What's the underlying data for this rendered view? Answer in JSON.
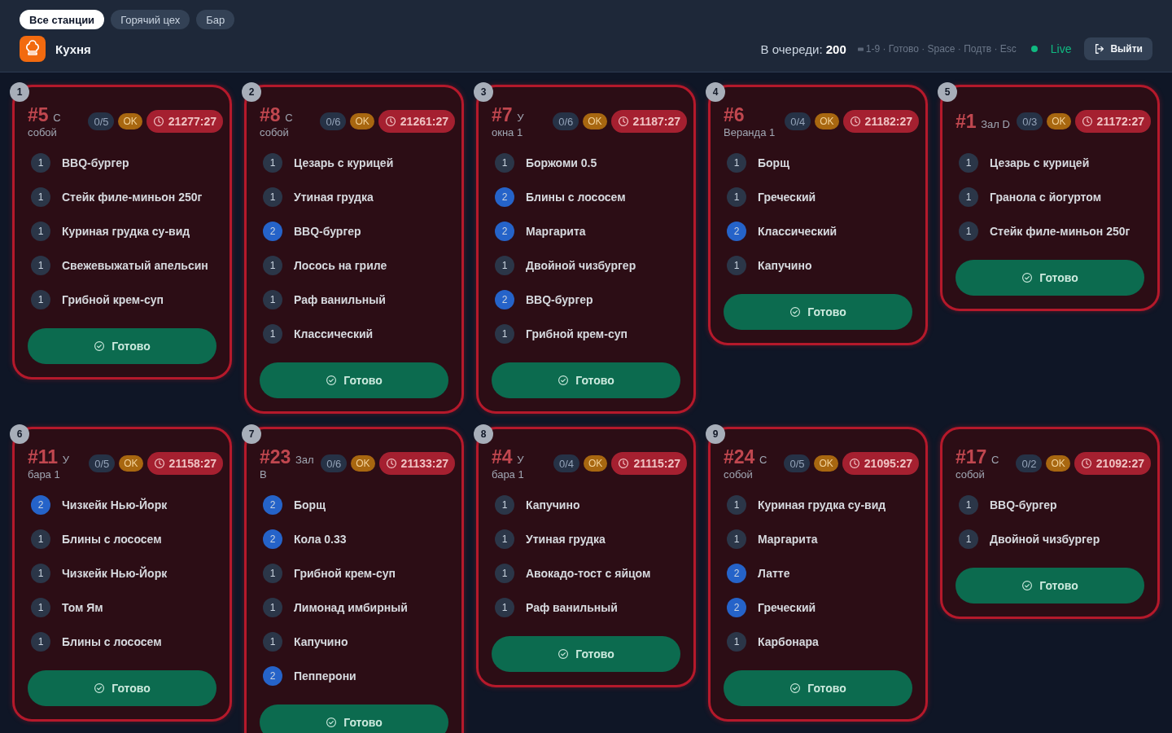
{
  "tabs": [
    {
      "label": "Все станции",
      "selected": true
    },
    {
      "label": "Горячий цех",
      "selected": false
    },
    {
      "label": "Бар",
      "selected": false
    }
  ],
  "station": {
    "title": "Кухня"
  },
  "queue": {
    "label": "В очереди:",
    "count": "200"
  },
  "hints": "1-9 · Готово · Space · Подтв · Esc",
  "live": {
    "label": "Live",
    "on": true
  },
  "logout": "Выйти",
  "orders": [
    {
      "hotkey": "1",
      "number": "#5",
      "place": "С собой",
      "progress": "0/5",
      "status": "OK",
      "timer": "21277:27",
      "overdue": true,
      "done_label": "Готово",
      "items": [
        {
          "qty": "1",
          "name": "BBQ-бургер",
          "color": "#2b3648"
        },
        {
          "qty": "1",
          "name": "Стейк филе-миньон 250г",
          "color": "#2b3648"
        },
        {
          "qty": "1",
          "name": "Куриная грудка су-вид",
          "color": "#2b3648"
        },
        {
          "qty": "1",
          "name": "Свежевыжатый апельсин",
          "color": "#2b3648"
        },
        {
          "qty": "1",
          "name": "Грибной крем-суп",
          "color": "#2b3648"
        }
      ]
    },
    {
      "hotkey": "2",
      "number": "#8",
      "place": "С собой",
      "progress": "0/6",
      "status": "OK",
      "timer": "21261:27",
      "overdue": true,
      "done_label": "Готово",
      "items": [
        {
          "qty": "1",
          "name": "Цезарь с курицей",
          "color": "#2b3648"
        },
        {
          "qty": "1",
          "name": "Утиная грудка",
          "color": "#2b3648"
        },
        {
          "qty": "2",
          "name": "BBQ-бургер",
          "color": "#2563c9"
        },
        {
          "qty": "1",
          "name": "Лосось на гриле",
          "color": "#2b3648"
        },
        {
          "qty": "1",
          "name": "Раф ванильный",
          "color": "#2b3648"
        },
        {
          "qty": "1",
          "name": "Классический",
          "color": "#2b3648"
        }
      ]
    },
    {
      "hotkey": "3",
      "number": "#7",
      "place": "У окна 1",
      "progress": "0/6",
      "status": "OK",
      "timer": "21187:27",
      "overdue": true,
      "done_label": "Готово",
      "items": [
        {
          "qty": "1",
          "name": "Боржоми 0.5",
          "color": "#2b3648"
        },
        {
          "qty": "2",
          "name": "Блины с лососем",
          "color": "#2563c9"
        },
        {
          "qty": "2",
          "name": "Маргарита",
          "color": "#2563c9"
        },
        {
          "qty": "1",
          "name": "Двойной чизбургер",
          "color": "#2b3648"
        },
        {
          "qty": "2",
          "name": "BBQ-бургер",
          "color": "#2563c9"
        },
        {
          "qty": "1",
          "name": "Грибной крем-суп",
          "color": "#2b3648"
        }
      ]
    },
    {
      "hotkey": "4",
      "number": "#6",
      "place": "Веранда 1",
      "progress": "0/4",
      "status": "OK",
      "timer": "21182:27",
      "overdue": true,
      "done_label": "Готово",
      "items": [
        {
          "qty": "1",
          "name": "Борщ",
          "color": "#2b3648"
        },
        {
          "qty": "1",
          "name": "Греческий",
          "color": "#2b3648"
        },
        {
          "qty": "2",
          "name": "Классический",
          "color": "#2563c9"
        },
        {
          "qty": "1",
          "name": "Капучино",
          "color": "#2b3648"
        }
      ]
    },
    {
      "hotkey": "5",
      "number": "#1",
      "place": "Зал D",
      "progress": "0/3",
      "status": "OK",
      "timer": "21172:27",
      "overdue": true,
      "done_label": "Готово",
      "items": [
        {
          "qty": "1",
          "name": "Цезарь с курицей",
          "color": "#2b3648"
        },
        {
          "qty": "1",
          "name": "Гранола с йогуртом",
          "color": "#2b3648"
        },
        {
          "qty": "1",
          "name": "Стейк филе-миньон 250г",
          "color": "#2b3648"
        }
      ]
    },
    {
      "hotkey": "6",
      "number": "#11",
      "place": "У бара 1",
      "progress": "0/5",
      "status": "OK",
      "timer": "21158:27",
      "overdue": true,
      "done_label": "Готово",
      "items": [
        {
          "qty": "2",
          "name": "Чизкейк Нью-Йорк",
          "color": "#2563c9"
        },
        {
          "qty": "1",
          "name": "Блины с лососем",
          "color": "#2b3648"
        },
        {
          "qty": "1",
          "name": "Чизкейк Нью-Йорк",
          "color": "#2b3648"
        },
        {
          "qty": "1",
          "name": "Том Ям",
          "color": "#2b3648"
        },
        {
          "qty": "1",
          "name": "Блины с лососем",
          "color": "#2b3648"
        }
      ]
    },
    {
      "hotkey": "7",
      "number": "#23",
      "place": "Зал B",
      "progress": "0/6",
      "status": "OK",
      "timer": "21133:27",
      "overdue": true,
      "done_label": "Готово",
      "items": [
        {
          "qty": "2",
          "name": "Борщ",
          "color": "#2563c9"
        },
        {
          "qty": "2",
          "name": "Кола 0.33",
          "color": "#2563c9"
        },
        {
          "qty": "1",
          "name": "Грибной крем-суп",
          "color": "#2b3648"
        },
        {
          "qty": "1",
          "name": "Лимонад имбирный",
          "color": "#2b3648"
        },
        {
          "qty": "1",
          "name": "Капучино",
          "color": "#2b3648"
        },
        {
          "qty": "2",
          "name": "Пепперони",
          "color": "#2563c9"
        }
      ]
    },
    {
      "hotkey": "8",
      "number": "#4",
      "place": "У бара 1",
      "progress": "0/4",
      "status": "OK",
      "timer": "21115:27",
      "overdue": true,
      "done_label": "Готово",
      "items": [
        {
          "qty": "1",
          "name": "Капучино",
          "color": "#2b3648"
        },
        {
          "qty": "1",
          "name": "Утиная грудка",
          "color": "#2b3648"
        },
        {
          "qty": "1",
          "name": "Авокадо-тост с яйцом",
          "color": "#2b3648"
        },
        {
          "qty": "1",
          "name": "Раф ванильный",
          "color": "#2b3648"
        }
      ]
    },
    {
      "hotkey": "9",
      "number": "#24",
      "place": "С собой",
      "progress": "0/5",
      "status": "OK",
      "timer": "21095:27",
      "overdue": true,
      "done_label": "Готово",
      "items": [
        {
          "qty": "1",
          "name": "Куриная грудка су-вид",
          "color": "#2b3648"
        },
        {
          "qty": "1",
          "name": "Маргарита",
          "color": "#2b3648"
        },
        {
          "qty": "2",
          "name": "Латте",
          "color": "#2563c9"
        },
        {
          "qty": "2",
          "name": "Греческий",
          "color": "#2563c9"
        },
        {
          "qty": "1",
          "name": "Карбонара",
          "color": "#2b3648"
        }
      ]
    },
    {
      "number": "#17",
      "place": "С собой",
      "progress": "0/2",
      "status": "OK",
      "timer": "21092:27",
      "overdue": true,
      "done_label": "Готово",
      "items": [
        {
          "qty": "1",
          "name": "BBQ-бургер",
          "color": "#2b3648"
        },
        {
          "qty": "1",
          "name": "Двойной чизбургер",
          "color": "#2b3648"
        }
      ]
    }
  ]
}
